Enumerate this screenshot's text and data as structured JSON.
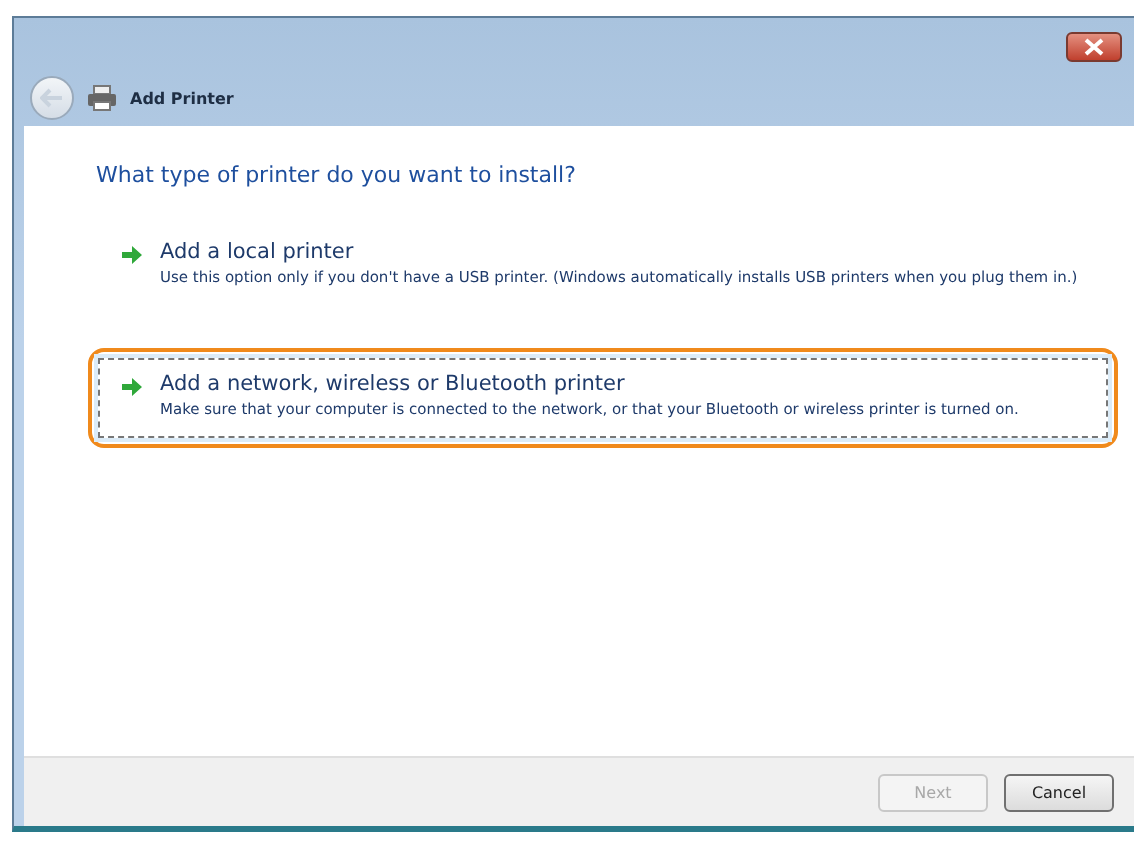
{
  "window": {
    "title": "Add Printer"
  },
  "heading": "What type of printer do you want to install?",
  "options": [
    {
      "title": "Add a local printer",
      "description": "Use this option only if you don't have a USB printer. (Windows automatically installs USB printers when you plug them in.)",
      "selected": false,
      "highlighted": false
    },
    {
      "title": "Add a network, wireless or Bluetooth printer",
      "description": "Make sure that your computer is connected to the network, or that your Bluetooth or wireless printer is turned on.",
      "selected": true,
      "highlighted": true
    }
  ],
  "buttons": [
    {
      "label": "Next",
      "disabled": true
    },
    {
      "label": "Cancel",
      "disabled": false
    }
  ]
}
